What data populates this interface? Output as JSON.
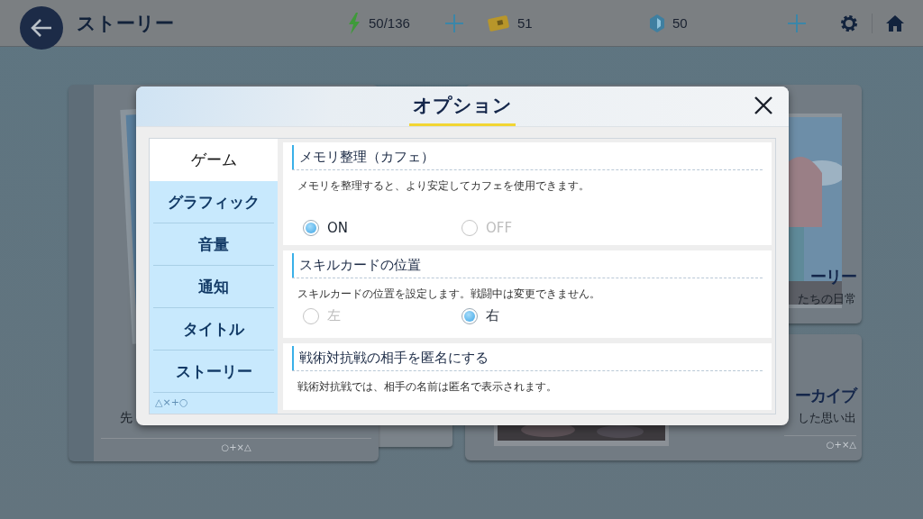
{
  "header": {
    "title": "ストーリー",
    "resources": [
      {
        "kind": "energy",
        "value": "50/136",
        "plus": true
      },
      {
        "kind": "credit",
        "value": "51",
        "plus": false
      },
      {
        "kind": "gem",
        "value": "50",
        "plus": true
      }
    ]
  },
  "left_cards": [
    {
      "subtitle": "先",
      "marks": "○+×△"
    }
  ],
  "right_cards": [
    {
      "title": "ーリー",
      "subtitle": "たちの日常"
    },
    {
      "title": "ーカイブ",
      "subtitle": "した思い出",
      "marks": "○+×△"
    }
  ],
  "dialog": {
    "title": "オプション",
    "corner_marks": "△×+○",
    "tabs": [
      {
        "label": "ゲーム",
        "selected": true
      },
      {
        "label": "グラフィック",
        "selected": false
      },
      {
        "label": "音量",
        "selected": false
      },
      {
        "label": "通知",
        "selected": false
      },
      {
        "label": "タイトル",
        "selected": false
      },
      {
        "label": "ストーリー",
        "selected": false
      }
    ],
    "sections": [
      {
        "title": "メモリ整理（カフェ）",
        "description": "メモリを整理すると、より安定してカフェを使用できます。",
        "options": [
          {
            "label": "ON",
            "selected": true
          },
          {
            "label": "OFF",
            "selected": false
          }
        ]
      },
      {
        "title": "スキルカードの位置",
        "description": "スキルカードの位置を設定します。戦闘中は変更できません。",
        "options": [
          {
            "label": "左",
            "selected": false
          },
          {
            "label": "右",
            "selected": true
          }
        ]
      },
      {
        "title": "戦術対抗戦の相手を匿名にする",
        "description": "戦術対抗戦では、相手の名前は匿名で表示されます。"
      }
    ]
  }
}
